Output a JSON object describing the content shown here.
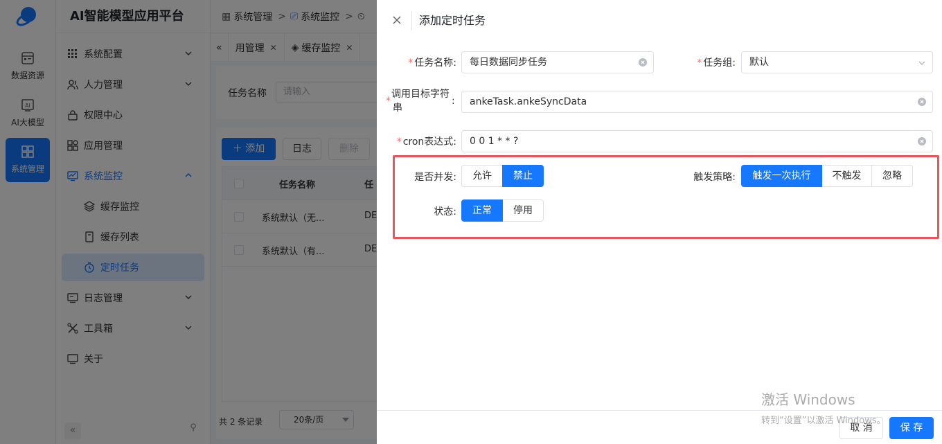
{
  "app": {
    "title": "AI智能模型应用平台",
    "rail": [
      {
        "label": "数据资源",
        "icon": "database-icon"
      },
      {
        "label": "AI大模型",
        "icon": "ai-icon"
      },
      {
        "label": "系统管理",
        "icon": "system-icon",
        "active": true
      }
    ],
    "menu": [
      {
        "label": "系统配置",
        "icon": "grid-icon",
        "expandable": true
      },
      {
        "label": "人力管理",
        "icon": "users-icon",
        "expandable": true
      },
      {
        "label": "权限中心",
        "icon": "lock-icon"
      },
      {
        "label": "应用管理",
        "icon": "apps-icon"
      },
      {
        "label": "系统监控",
        "icon": "monitor-icon",
        "expanded": true
      },
      {
        "label": "缓存监控",
        "icon": "layers-icon",
        "sub": true
      },
      {
        "label": "缓存列表",
        "icon": "document-icon",
        "sub": true
      },
      {
        "label": "定时任务",
        "icon": "clock-icon",
        "sub": true,
        "active": true
      },
      {
        "label": "日志管理",
        "icon": "log-icon",
        "expandable": true
      },
      {
        "label": "工具箱",
        "icon": "tools-icon",
        "expandable": true
      },
      {
        "label": "关于",
        "icon": "info-icon"
      }
    ],
    "breadcrumb": [
      "系统管理",
      "系统监控"
    ],
    "tabs": [
      {
        "label": "用管理"
      },
      {
        "label": "缓存监控"
      }
    ],
    "search": {
      "label": "任务名称",
      "placeholder": "请输入"
    },
    "toolbar": {
      "add": "添加",
      "log": "日志",
      "delete": "删除"
    },
    "table": {
      "headers": [
        "任务名称",
        "任"
      ],
      "rows": [
        {
          "name": "系统默认（无...",
          "group": "DE"
        },
        {
          "name": "系统默认（有...",
          "group": "DE"
        }
      ]
    },
    "pager": {
      "total": "共 2 条记录",
      "size": "20条/页"
    }
  },
  "drawer": {
    "title": "添加定时任务",
    "fields": {
      "task_name": {
        "label": "任务名称:",
        "value": "每日数据同步任务"
      },
      "task_group": {
        "label": "任务组:",
        "value": "默认"
      },
      "invoke_target": {
        "label_line1": "调用目标字符",
        "label_line2": "串",
        "colon": ":",
        "value": "ankeTask.ankeSyncData"
      },
      "cron": {
        "label": "cron表达式:",
        "value": "0 0 1 * * ?"
      }
    },
    "concurrent": {
      "label": "是否并发:",
      "options": [
        "允许",
        "禁止"
      ],
      "selected": "禁止"
    },
    "misfire": {
      "label": "触发策略:",
      "options": [
        "触发一次执行",
        "不触发",
        "忽略"
      ],
      "selected": "触发一次执行"
    },
    "status": {
      "label": "状态:",
      "options": [
        "正常",
        "停用"
      ],
      "selected": "正常"
    },
    "footer": {
      "cancel": "取 消",
      "save": "保 存"
    }
  },
  "watermark": {
    "line1": "激活 Windows",
    "line2": "转到“设置”以激活 Windows。"
  },
  "colors": {
    "primary": "#1677ff",
    "required": "#f56c6c",
    "highlight": "#e8555c"
  }
}
